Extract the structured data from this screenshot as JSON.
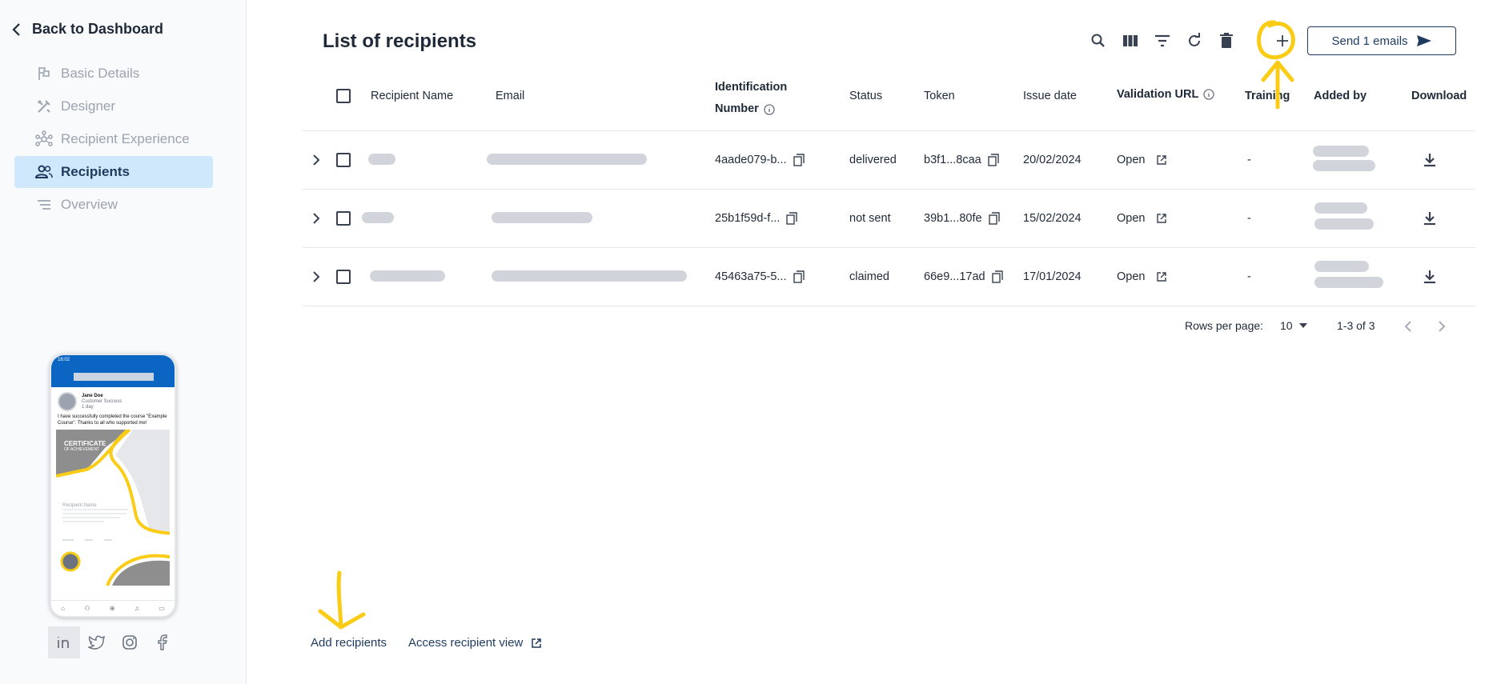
{
  "sidebar": {
    "back_label": "Back to Dashboard",
    "items": [
      {
        "label": "Basic Details",
        "icon": "flag-icon",
        "active": false
      },
      {
        "label": "Designer",
        "icon": "tools-icon",
        "active": false
      },
      {
        "label": "Recipient Experience",
        "icon": "network-icon",
        "active": false
      },
      {
        "label": "Recipients",
        "icon": "people-icon",
        "active": true
      },
      {
        "label": "Overview",
        "icon": "list-icon",
        "active": false
      }
    ],
    "preview": {
      "time": "16:02",
      "author": "Jane Doe",
      "role": "Customer Success",
      "age": "1 day",
      "post_text": "I have successfully completed the course \"Example Course\". Thanks to all who supported me!",
      "cert_title": "CERTIFICATE",
      "cert_subtitle": "OF ACHIEVEMENT",
      "cert_recipient": "Recipient Name"
    },
    "social": [
      "linkedin-icon",
      "twitter-icon",
      "instagram-icon",
      "facebook-icon"
    ]
  },
  "main": {
    "title": "List of recipients",
    "send_label": "Send 1 emails",
    "columns": {
      "name": "Recipient Name",
      "email": "Email",
      "id_line1": "Identification",
      "id_line2": "Number",
      "status": "Status",
      "token": "Token",
      "issue": "Issue date",
      "validation": "Validation URL",
      "training": "Training",
      "added": "Added by",
      "download": "Download"
    },
    "rows": [
      {
        "id": "4aade079-b...",
        "status": "delivered",
        "token": "b3f1...8caa",
        "issue": "20/02/2024",
        "validation": "Open",
        "training": "-"
      },
      {
        "id": "25b1f59d-f...",
        "status": "not sent",
        "token": "39b1...80fe",
        "issue": "15/02/2024",
        "validation": "Open",
        "training": "-"
      },
      {
        "id": "45463a75-5...",
        "status": "claimed",
        "token": "66e9...17ad",
        "issue": "17/01/2024",
        "validation": "Open",
        "training": "-"
      }
    ],
    "pager": {
      "rows_label": "Rows per page:",
      "rows_value": "10",
      "range": "1-3 of 3"
    },
    "add_recipients": "Add recipients",
    "access_view": "Access recipient view"
  },
  "colors": {
    "accent": "#1f3a5f",
    "active_bg": "#cfe8fc",
    "annotation": "#facc15"
  }
}
